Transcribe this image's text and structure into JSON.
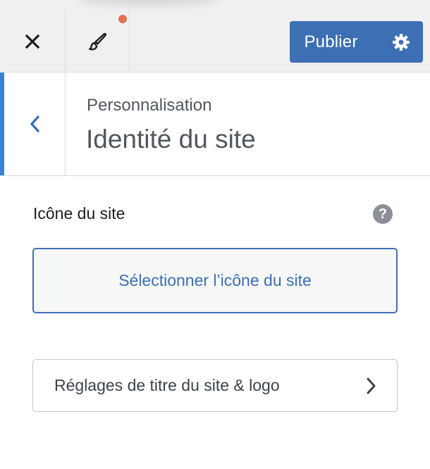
{
  "toolbar": {
    "publish_label": "Publier",
    "close_icon": "close-icon",
    "brush_icon": "paintbrush-icon",
    "settings_icon": "gear-icon"
  },
  "section": {
    "breadcrumb": "Personnalisation",
    "title": "Identité du site"
  },
  "site_icon": {
    "label": "Icône du site",
    "help_glyph": "?",
    "select_button": "Sélectionner l’icône du site"
  },
  "nav": {
    "title_logo": "Réglages de titre du site & logo"
  },
  "colors": {
    "accent": "#3d6fb4",
    "notification": "#e26f56",
    "active_border": "#3d7fd6"
  }
}
